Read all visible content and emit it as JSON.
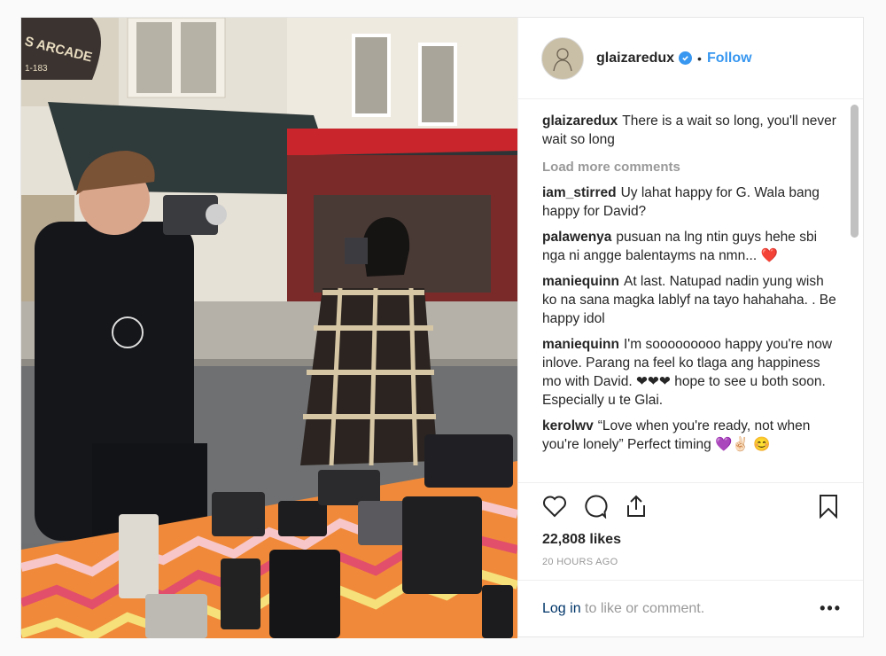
{
  "post": {
    "username": "glaizaredux",
    "follow_label": "Follow",
    "separator": "•",
    "shop_sign": "S ARCADE",
    "shop_sign_num": "1-183",
    "caption": {
      "user": "glaizaredux",
      "text": "There is a wait so long, you'll never wait so long"
    },
    "load_more": "Load more comments",
    "comments": [
      {
        "user": "iam_stirred",
        "text": "Uy lahat happy for G. Wala bang happy for David?"
      },
      {
        "user": "palawenya",
        "text": "pusuan na lng ntin guys hehe sbi nga ni angge balentayms na nmn... ❤️"
      },
      {
        "user": "maniequinn",
        "text": "At last. Natupad nadin yung wish ko na sana magka lablyf na tayo hahahaha. . Be happy idol"
      },
      {
        "user": "maniequinn",
        "text": "I'm sooooooooo happy you're now inlove. Parang na feel ko tlaga ang happiness mo with David. ❤❤❤ hope to see u both soon. Especially u te Glai."
      },
      {
        "user": "kerolwv",
        "text": "“Love when you're ready, not when you're lonely” Perfect timing 💜✌🏻 😊"
      }
    ],
    "likes": "22,808 likes",
    "time": "20 HOURS AGO",
    "login_link": "Log in",
    "login_rest": " to like or comment.",
    "more": "•••"
  },
  "icons": [
    "heart-icon",
    "comment-icon",
    "share-icon",
    "bookmark-icon",
    "verified-icon"
  ],
  "colors": {
    "accent": "#3897f0",
    "link_dark": "#003569",
    "muted": "#999999"
  }
}
